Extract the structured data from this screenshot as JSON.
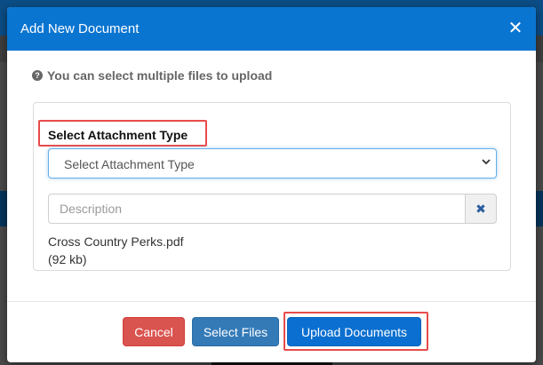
{
  "modal": {
    "title": "Add New Document",
    "close_symbol": "✕"
  },
  "hint": {
    "icon": "question-circle-icon",
    "text": "You can select multiple files to upload"
  },
  "attachment": {
    "label": "Select Attachment Type",
    "select_value": "Select Attachment Type"
  },
  "description": {
    "placeholder": "Description",
    "value": "",
    "clear_symbol": "✖"
  },
  "file": {
    "name": "Cross Country Perks.pdf",
    "size": "(92 kb)"
  },
  "buttons": {
    "cancel": "Cancel",
    "select_files": "Select Files",
    "upload": "Upload Documents"
  },
  "colors": {
    "header": "#0a75d1",
    "cancel": "#d9534f",
    "select_files": "#337ab7",
    "upload": "#0a6fd0",
    "highlight": "#e84b4b"
  }
}
